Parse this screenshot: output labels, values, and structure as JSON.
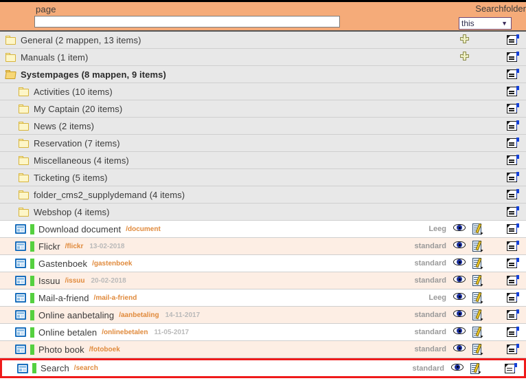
{
  "header": {
    "search_label": "page",
    "search_value": "",
    "search_placeholder": "",
    "searchfolder_label": "Searchfolder",
    "searchfolder_value": "this",
    "searchfolder_caret": "▼",
    "colors": {
      "header_bg": "#f5ab79",
      "accent": "#e08a3c",
      "highlight": "#ef1a1a"
    }
  },
  "rows": [
    {
      "type": "folder",
      "indent": 1,
      "icon": "folder-closed-icon",
      "name": "General (2 mappen, 13 items)",
      "bold": false,
      "slug": "",
      "date": "",
      "status": "",
      "has_plus": true,
      "has_props": true,
      "has_eye": false,
      "has_edit": false,
      "highlight": false
    },
    {
      "type": "folder",
      "indent": 1,
      "icon": "folder-closed-icon",
      "name": "Manuals (1 item)",
      "bold": false,
      "slug": "",
      "date": "",
      "status": "",
      "has_plus": true,
      "has_props": true,
      "has_eye": false,
      "has_edit": false,
      "highlight": false
    },
    {
      "type": "folder",
      "indent": 1,
      "icon": "folder-open-icon",
      "name": "Systempages (8 mappen, 9 items)",
      "bold": true,
      "slug": "",
      "date": "",
      "status": "",
      "has_plus": false,
      "has_props": true,
      "has_eye": false,
      "has_edit": false,
      "highlight": false
    },
    {
      "type": "folder",
      "indent": 2,
      "icon": "folder-closed-icon",
      "name": "Activities (10 items)",
      "bold": false,
      "slug": "",
      "date": "",
      "status": "",
      "has_plus": false,
      "has_props": true,
      "has_eye": false,
      "has_edit": false,
      "highlight": false
    },
    {
      "type": "folder",
      "indent": 2,
      "icon": "folder-closed-icon",
      "name": "My Captain (20 items)",
      "bold": false,
      "slug": "",
      "date": "",
      "status": "",
      "has_plus": false,
      "has_props": true,
      "has_eye": false,
      "has_edit": false,
      "highlight": false
    },
    {
      "type": "folder",
      "indent": 2,
      "icon": "folder-closed-icon",
      "name": "News (2 items)",
      "bold": false,
      "slug": "",
      "date": "",
      "status": "",
      "has_plus": false,
      "has_props": true,
      "has_eye": false,
      "has_edit": false,
      "highlight": false
    },
    {
      "type": "folder",
      "indent": 2,
      "icon": "folder-closed-icon",
      "name": "Reservation (7 items)",
      "bold": false,
      "slug": "",
      "date": "",
      "status": "",
      "has_plus": false,
      "has_props": true,
      "has_eye": false,
      "has_edit": false,
      "highlight": false
    },
    {
      "type": "folder",
      "indent": 2,
      "icon": "folder-closed-icon",
      "name": "Miscellaneous (4 items)",
      "bold": false,
      "slug": "",
      "date": "",
      "status": "",
      "has_plus": false,
      "has_props": true,
      "has_eye": false,
      "has_edit": false,
      "highlight": false
    },
    {
      "type": "folder",
      "indent": 2,
      "icon": "folder-closed-icon",
      "name": "Ticketing (5 items)",
      "bold": false,
      "slug": "",
      "date": "",
      "status": "",
      "has_plus": false,
      "has_props": true,
      "has_eye": false,
      "has_edit": false,
      "highlight": false
    },
    {
      "type": "folder",
      "indent": 2,
      "icon": "folder-closed-icon",
      "name": "folder_cms2_supplydemand (4 items)",
      "bold": false,
      "slug": "",
      "date": "",
      "status": "",
      "has_plus": false,
      "has_props": true,
      "has_eye": false,
      "has_edit": false,
      "highlight": false
    },
    {
      "type": "folder",
      "indent": 2,
      "icon": "folder-closed-icon",
      "name": "Webshop (4 items)",
      "bold": false,
      "slug": "",
      "date": "",
      "status": "",
      "has_plus": false,
      "has_props": true,
      "has_eye": false,
      "has_edit": false,
      "highlight": false
    },
    {
      "type": "page",
      "indent": 2,
      "icon": "page-icon",
      "name": "Download document",
      "bold": false,
      "slug": "/document",
      "date": "",
      "status": "Leeg",
      "has_plus": false,
      "has_props": true,
      "has_eye": true,
      "has_edit": true,
      "highlight": false
    },
    {
      "type": "page",
      "indent": 2,
      "icon": "page-icon",
      "name": "Flickr",
      "bold": false,
      "slug": "/flickr",
      "date": "13-02-2018",
      "status": "standard",
      "has_plus": false,
      "has_props": true,
      "has_eye": true,
      "has_edit": true,
      "highlight": false
    },
    {
      "type": "page",
      "indent": 2,
      "icon": "page-icon",
      "name": "Gastenboek",
      "bold": false,
      "slug": "/gastenboek",
      "date": "",
      "status": "standard",
      "has_plus": false,
      "has_props": true,
      "has_eye": true,
      "has_edit": true,
      "highlight": false
    },
    {
      "type": "page",
      "indent": 2,
      "icon": "page-icon",
      "name": "Issuu",
      "bold": false,
      "slug": "/issuu",
      "date": "20-02-2018",
      "status": "standard",
      "has_plus": false,
      "has_props": true,
      "has_eye": true,
      "has_edit": true,
      "highlight": false
    },
    {
      "type": "page",
      "indent": 2,
      "icon": "page-icon",
      "name": "Mail-a-friend",
      "bold": false,
      "slug": "/mail-a-friend",
      "date": "",
      "status": "Leeg",
      "has_plus": false,
      "has_props": true,
      "has_eye": true,
      "has_edit": true,
      "highlight": false
    },
    {
      "type": "page",
      "indent": 2,
      "icon": "page-icon",
      "name": "Online aanbetaling",
      "bold": false,
      "slug": "/aanbetaling",
      "date": "14-11-2017",
      "status": "standard",
      "has_plus": false,
      "has_props": true,
      "has_eye": true,
      "has_edit": true,
      "highlight": false
    },
    {
      "type": "page",
      "indent": 2,
      "icon": "page-icon",
      "name": "Online betalen",
      "bold": false,
      "slug": "/onlinebetalen",
      "date": "11-05-2017",
      "status": "standard",
      "has_plus": false,
      "has_props": true,
      "has_eye": true,
      "has_edit": true,
      "highlight": false
    },
    {
      "type": "page",
      "indent": 2,
      "icon": "page-icon",
      "name": "Photo book",
      "bold": false,
      "slug": "/fotoboek",
      "date": "",
      "status": "standard",
      "has_plus": false,
      "has_props": true,
      "has_eye": true,
      "has_edit": true,
      "highlight": false
    },
    {
      "type": "page",
      "indent": 2,
      "icon": "page-icon",
      "name": "Search",
      "bold": false,
      "slug": "/search",
      "date": "",
      "status": "standard",
      "has_plus": false,
      "has_props": true,
      "has_eye": true,
      "has_edit": true,
      "highlight": true
    }
  ]
}
